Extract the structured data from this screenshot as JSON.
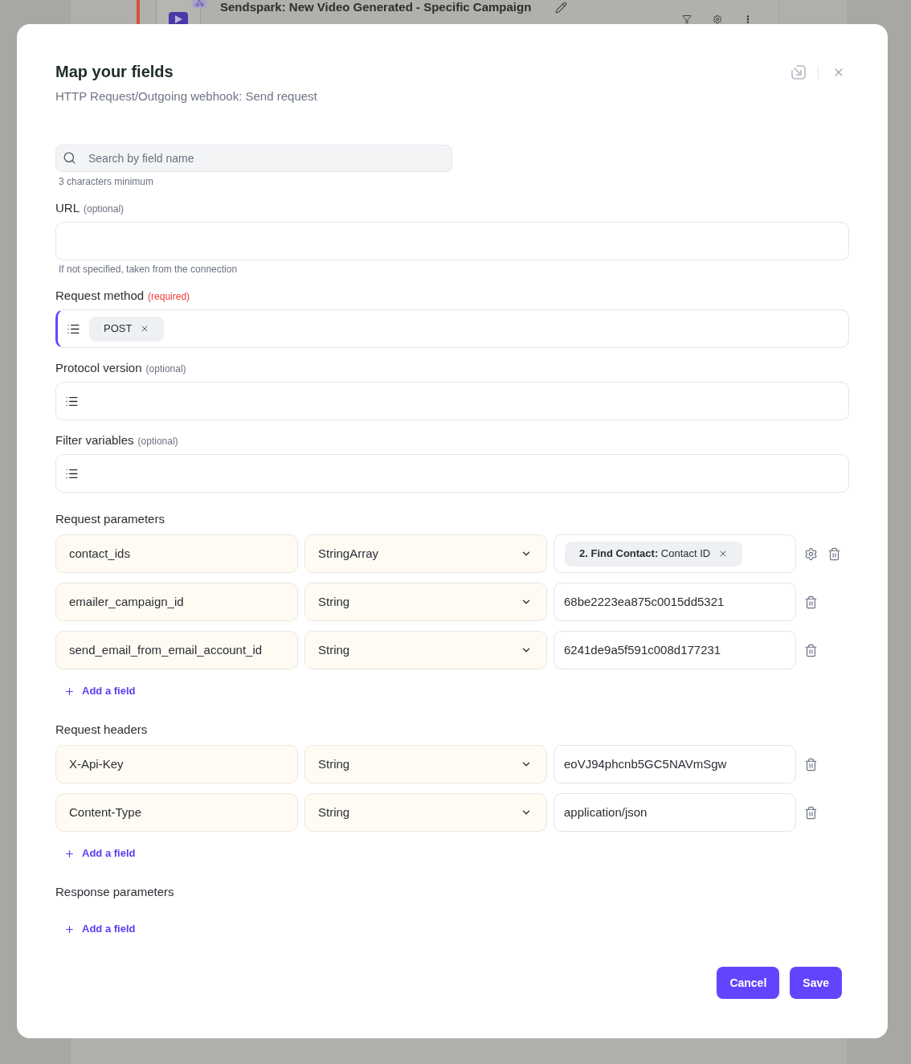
{
  "background": {
    "node_title": "Sendspark: New Video Generated - Specific Campaign"
  },
  "dialog": {
    "title": "Map your fields",
    "subtitle": "HTTP Request/Outgoing webhook: Send request"
  },
  "search": {
    "placeholder": "Search by field name",
    "hint": "3 characters minimum"
  },
  "fields": [
    {
      "kind": "text",
      "label": "URL",
      "note": "(optional)",
      "required": false,
      "focused": false,
      "hint": "If not specified, taken from the connection"
    },
    {
      "kind": "list",
      "label": "Request method",
      "note": "(required)",
      "required": true,
      "focused": true,
      "chips": [
        "POST"
      ]
    },
    {
      "kind": "list",
      "label": "Protocol version",
      "note": "(optional)",
      "required": false,
      "focused": false
    },
    {
      "kind": "list",
      "label": "Filter variables",
      "note": "(optional)",
      "required": false,
      "focused": false
    }
  ],
  "groups": [
    {
      "title": "Request parameters",
      "rows": [
        {
          "kind": "chip",
          "name": "contact_ids",
          "type": "StringArray",
          "value": "**2. Find Contact:** Contact ID",
          "settings": true
        },
        {
          "kind": "text",
          "name": "emailer_campaign_id",
          "type": "String",
          "value": "68be2223ea875c0015dd5321",
          "settings": false
        },
        {
          "kind": "text",
          "name": "send_email_from_email_account_id",
          "type": "String",
          "value": "6241de9a5f591c008d177231",
          "settings": false
        }
      ],
      "add_label": "Add a field"
    },
    {
      "title": "Request headers",
      "rows": [
        {
          "kind": "text",
          "name": "X-Api-Key",
          "type": "String",
          "value": "eoVJ94phcnb5GC5NAVmSgw",
          "settings": false
        },
        {
          "kind": "text",
          "name": "Content-Type",
          "type": "String",
          "value": "application/json",
          "settings": false
        }
      ],
      "add_label": "Add a field"
    },
    {
      "title": "Response parameters",
      "add_label": "Add a field"
    }
  ],
  "buttons": [
    {
      "label": "Cancel"
    },
    {
      "label": "Save"
    }
  ]
}
